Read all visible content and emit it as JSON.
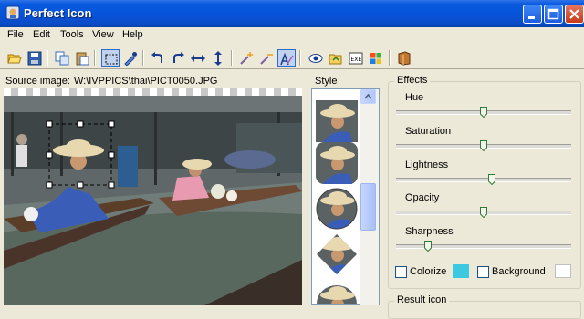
{
  "window": {
    "title": "Perfect Icon"
  },
  "menu": [
    "File",
    "Edit",
    "Tools",
    "View",
    "Help"
  ],
  "toolbar": {
    "buttons": [
      "open-icon",
      "save-icon",
      "copy-icon",
      "paste-icon",
      "select-icon",
      "picker-icon",
      "rotate-left-icon",
      "rotate-right-icon",
      "flip-horizontal-icon",
      "flip-vertical-icon",
      "wand-add-icon",
      "wand-remove-icon",
      "auto-fit-icon",
      "preview-icon",
      "export-icon",
      "extract-icon",
      "windows-icon",
      "help-book-icon"
    ],
    "active": "auto-fit-icon"
  },
  "source": {
    "label": "Source image:",
    "path": "W:\\IVPPICS\\thai\\PICT0050.JPG"
  },
  "style_panel": {
    "label": "Style"
  },
  "effects": {
    "label": "Effects",
    "sliders": [
      {
        "name": "Hue",
        "value": 0.5
      },
      {
        "name": "Saturation",
        "value": 0.5
      },
      {
        "name": "Lightness",
        "value": 0.55
      },
      {
        "name": "Opacity",
        "value": 0.5
      },
      {
        "name": "Sharpness",
        "value": 0.17
      }
    ],
    "colorize_label": "Colorize",
    "colorize_checked": false,
    "colorize_color": "#3CC8E0",
    "background_label": "Background",
    "background_checked": false,
    "background_color": "#FFFFFF"
  },
  "result": {
    "label": "Result icon"
  },
  "colors": {
    "titlebar": "#0654DA",
    "face": "#ECE9D8",
    "accent": "#316AC5"
  }
}
